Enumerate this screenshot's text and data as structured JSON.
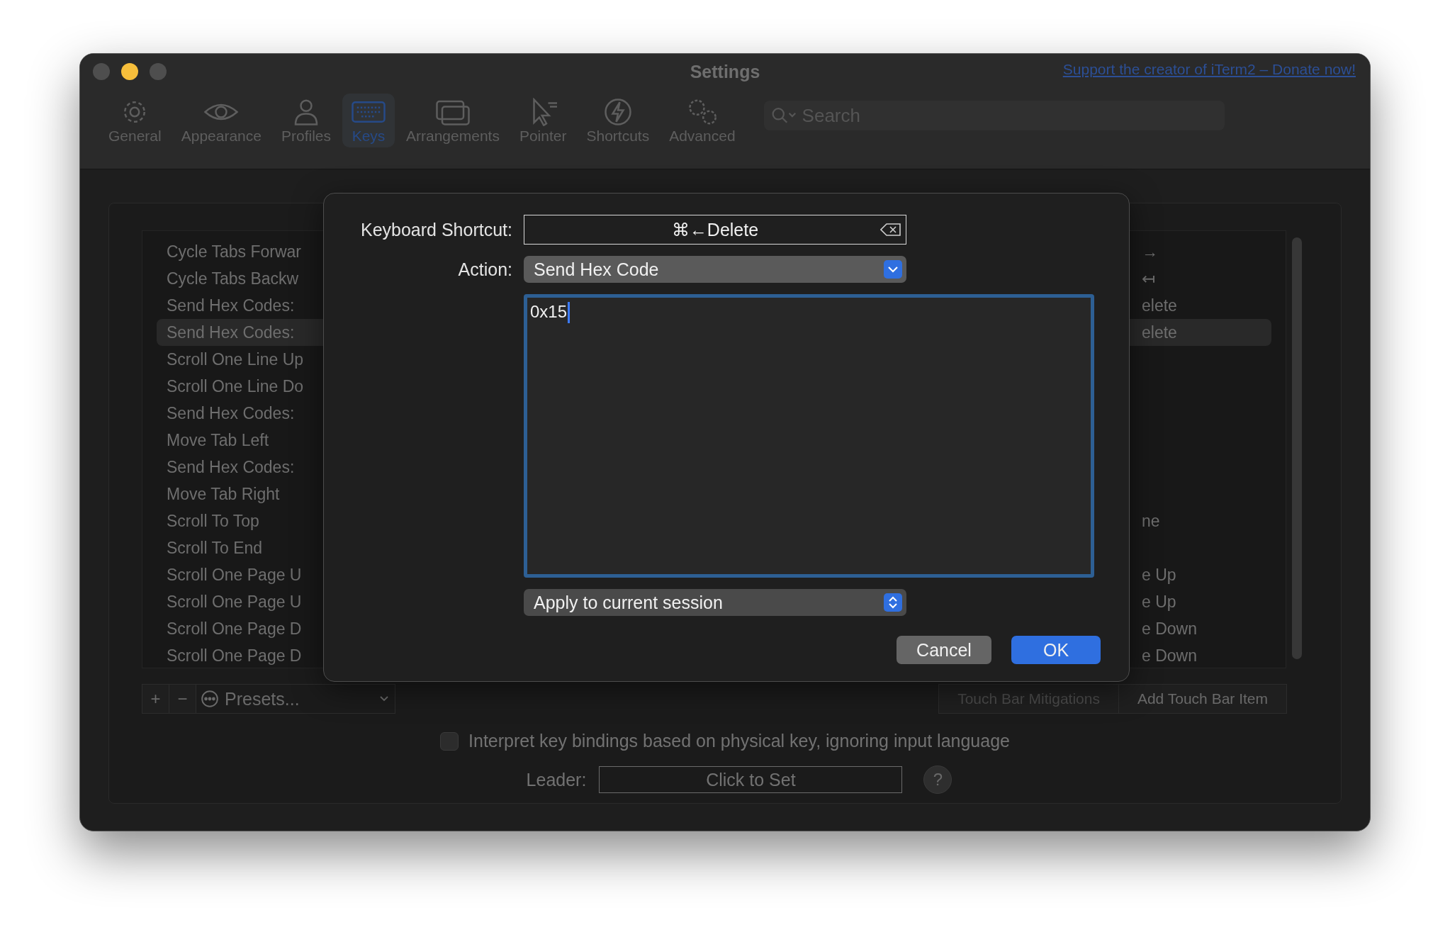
{
  "window": {
    "title": "Settings",
    "link": "Support the creator of iTerm2 – Donate now!"
  },
  "toolbar": {
    "items": [
      {
        "label": "General",
        "kind": "general",
        "selected": false
      },
      {
        "label": "Appearance",
        "kind": "appearance",
        "selected": false
      },
      {
        "label": "Profiles",
        "kind": "profiles",
        "selected": false
      },
      {
        "label": "Keys",
        "kind": "keys",
        "selected": true
      },
      {
        "label": "Arrangements",
        "kind": "arrangements",
        "selected": false
      },
      {
        "label": "Pointer",
        "kind": "pointer",
        "selected": false
      },
      {
        "label": "Shortcuts",
        "kind": "shortcuts",
        "selected": false
      },
      {
        "label": "Advanced",
        "kind": "advanced",
        "selected": false
      }
    ],
    "search": {
      "placeholder": "Search"
    }
  },
  "bindings": {
    "rows": [
      {
        "action": "Cycle Tabs Forwar",
        "shortcut": "→",
        "selected": false
      },
      {
        "action": "Cycle Tabs Backw",
        "shortcut": "↤",
        "selected": false
      },
      {
        "action": "Send Hex Codes:",
        "shortcut": "elete",
        "selected": false
      },
      {
        "action": "Send Hex Codes:",
        "shortcut": "elete",
        "selected": true
      },
      {
        "action": "Scroll One Line Up",
        "selected": false
      },
      {
        "action": "Scroll One Line Do",
        "selected": false
      },
      {
        "action": "Send Hex Codes:",
        "selected": false
      },
      {
        "action": "Move Tab Left",
        "selected": false
      },
      {
        "action": "Send Hex Codes:",
        "selected": false
      },
      {
        "action": "Move Tab Right",
        "selected": false
      },
      {
        "action": "Scroll To Top",
        "shortcut": "ne",
        "selected": false
      },
      {
        "action": "Scroll To End",
        "selected": false
      },
      {
        "action": "Scroll One Page U",
        "shortcut": "e Up",
        "selected": false
      },
      {
        "action": "Scroll One Page U",
        "shortcut": "e Up",
        "selected": false
      },
      {
        "action": "Scroll One Page D",
        "shortcut": "e Down",
        "selected": false
      },
      {
        "action": "Scroll One Page D",
        "shortcut": "e Down",
        "selected": false
      }
    ]
  },
  "bottom_bar": {
    "add": "+",
    "remove": "−",
    "presets": "Presets...",
    "buttons": [
      "Touch Bar Mitigations",
      "Add Touch Bar Item"
    ]
  },
  "physical_key": {
    "label": "Interpret key bindings based on physical key, ignoring input language",
    "checked": false
  },
  "leader": {
    "label": "Leader:",
    "value": "Click to Set",
    "help": "?"
  },
  "dialog": {
    "shortcut_label": "Keyboard Shortcut:",
    "shortcut": "⌘←Delete",
    "action_label": "Action:",
    "action": "Send Hex Code",
    "value": "0x15",
    "scope": "Apply to current session",
    "buttons": [
      {
        "label": "Cancel",
        "default": false
      },
      {
        "label": "OK",
        "default": true
      }
    ]
  }
}
